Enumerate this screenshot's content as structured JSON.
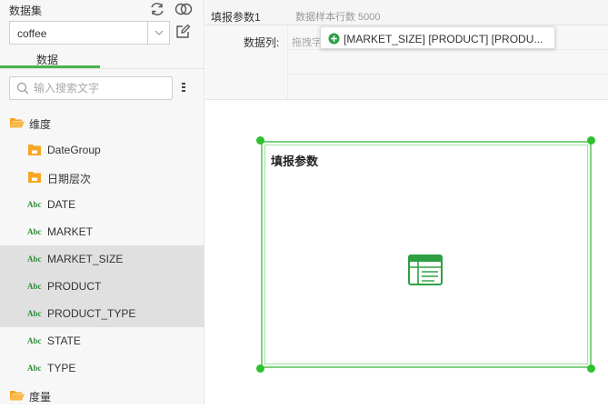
{
  "sidebar": {
    "title": "数据集",
    "refresh_icon": "refresh-icon",
    "link_icon": "link-dataset-icon",
    "dataset_select": {
      "value": "coffee"
    },
    "edit_icon": "edit-icon",
    "tab": {
      "label": "数据"
    },
    "search": {
      "placeholder": "输入搜索文字"
    },
    "tree": [
      {
        "type": "folder",
        "label": "维度",
        "level": 0
      },
      {
        "type": "folder",
        "label": "DateGroup",
        "level": 1
      },
      {
        "type": "folder",
        "label": "日期层次",
        "level": 1
      },
      {
        "type": "field",
        "tag": "Abc",
        "label": "DATE",
        "selected": false
      },
      {
        "type": "field",
        "tag": "Abc",
        "label": "MARKET",
        "selected": false
      },
      {
        "type": "field",
        "tag": "Abc",
        "label": "MARKET_SIZE",
        "selected": true
      },
      {
        "type": "field",
        "tag": "Abc",
        "label": "PRODUCT",
        "selected": true
      },
      {
        "type": "field",
        "tag": "Abc",
        "label": "PRODUCT_TYPE",
        "selected": true
      },
      {
        "type": "field",
        "tag": "Abc",
        "label": "STATE",
        "selected": false
      },
      {
        "type": "field",
        "tag": "Abc",
        "label": "TYPE",
        "selected": false
      },
      {
        "type": "folder",
        "label": "度量",
        "level": 0
      }
    ]
  },
  "main": {
    "header": {
      "title": "填报参数1",
      "sample_info": "数据样本行数 5000"
    },
    "data_columns": {
      "label": "数据列:",
      "placeholder": "拖拽字",
      "drag_chip": "[MARKET_SIZE] [PRODUCT] [PRODU..."
    },
    "component": {
      "title": "填报参数",
      "icon": "table-icon"
    }
  },
  "colors": {
    "accent": "#49b24a",
    "folder": "#f6a623",
    "abc_tag": "#2e8b3a"
  }
}
